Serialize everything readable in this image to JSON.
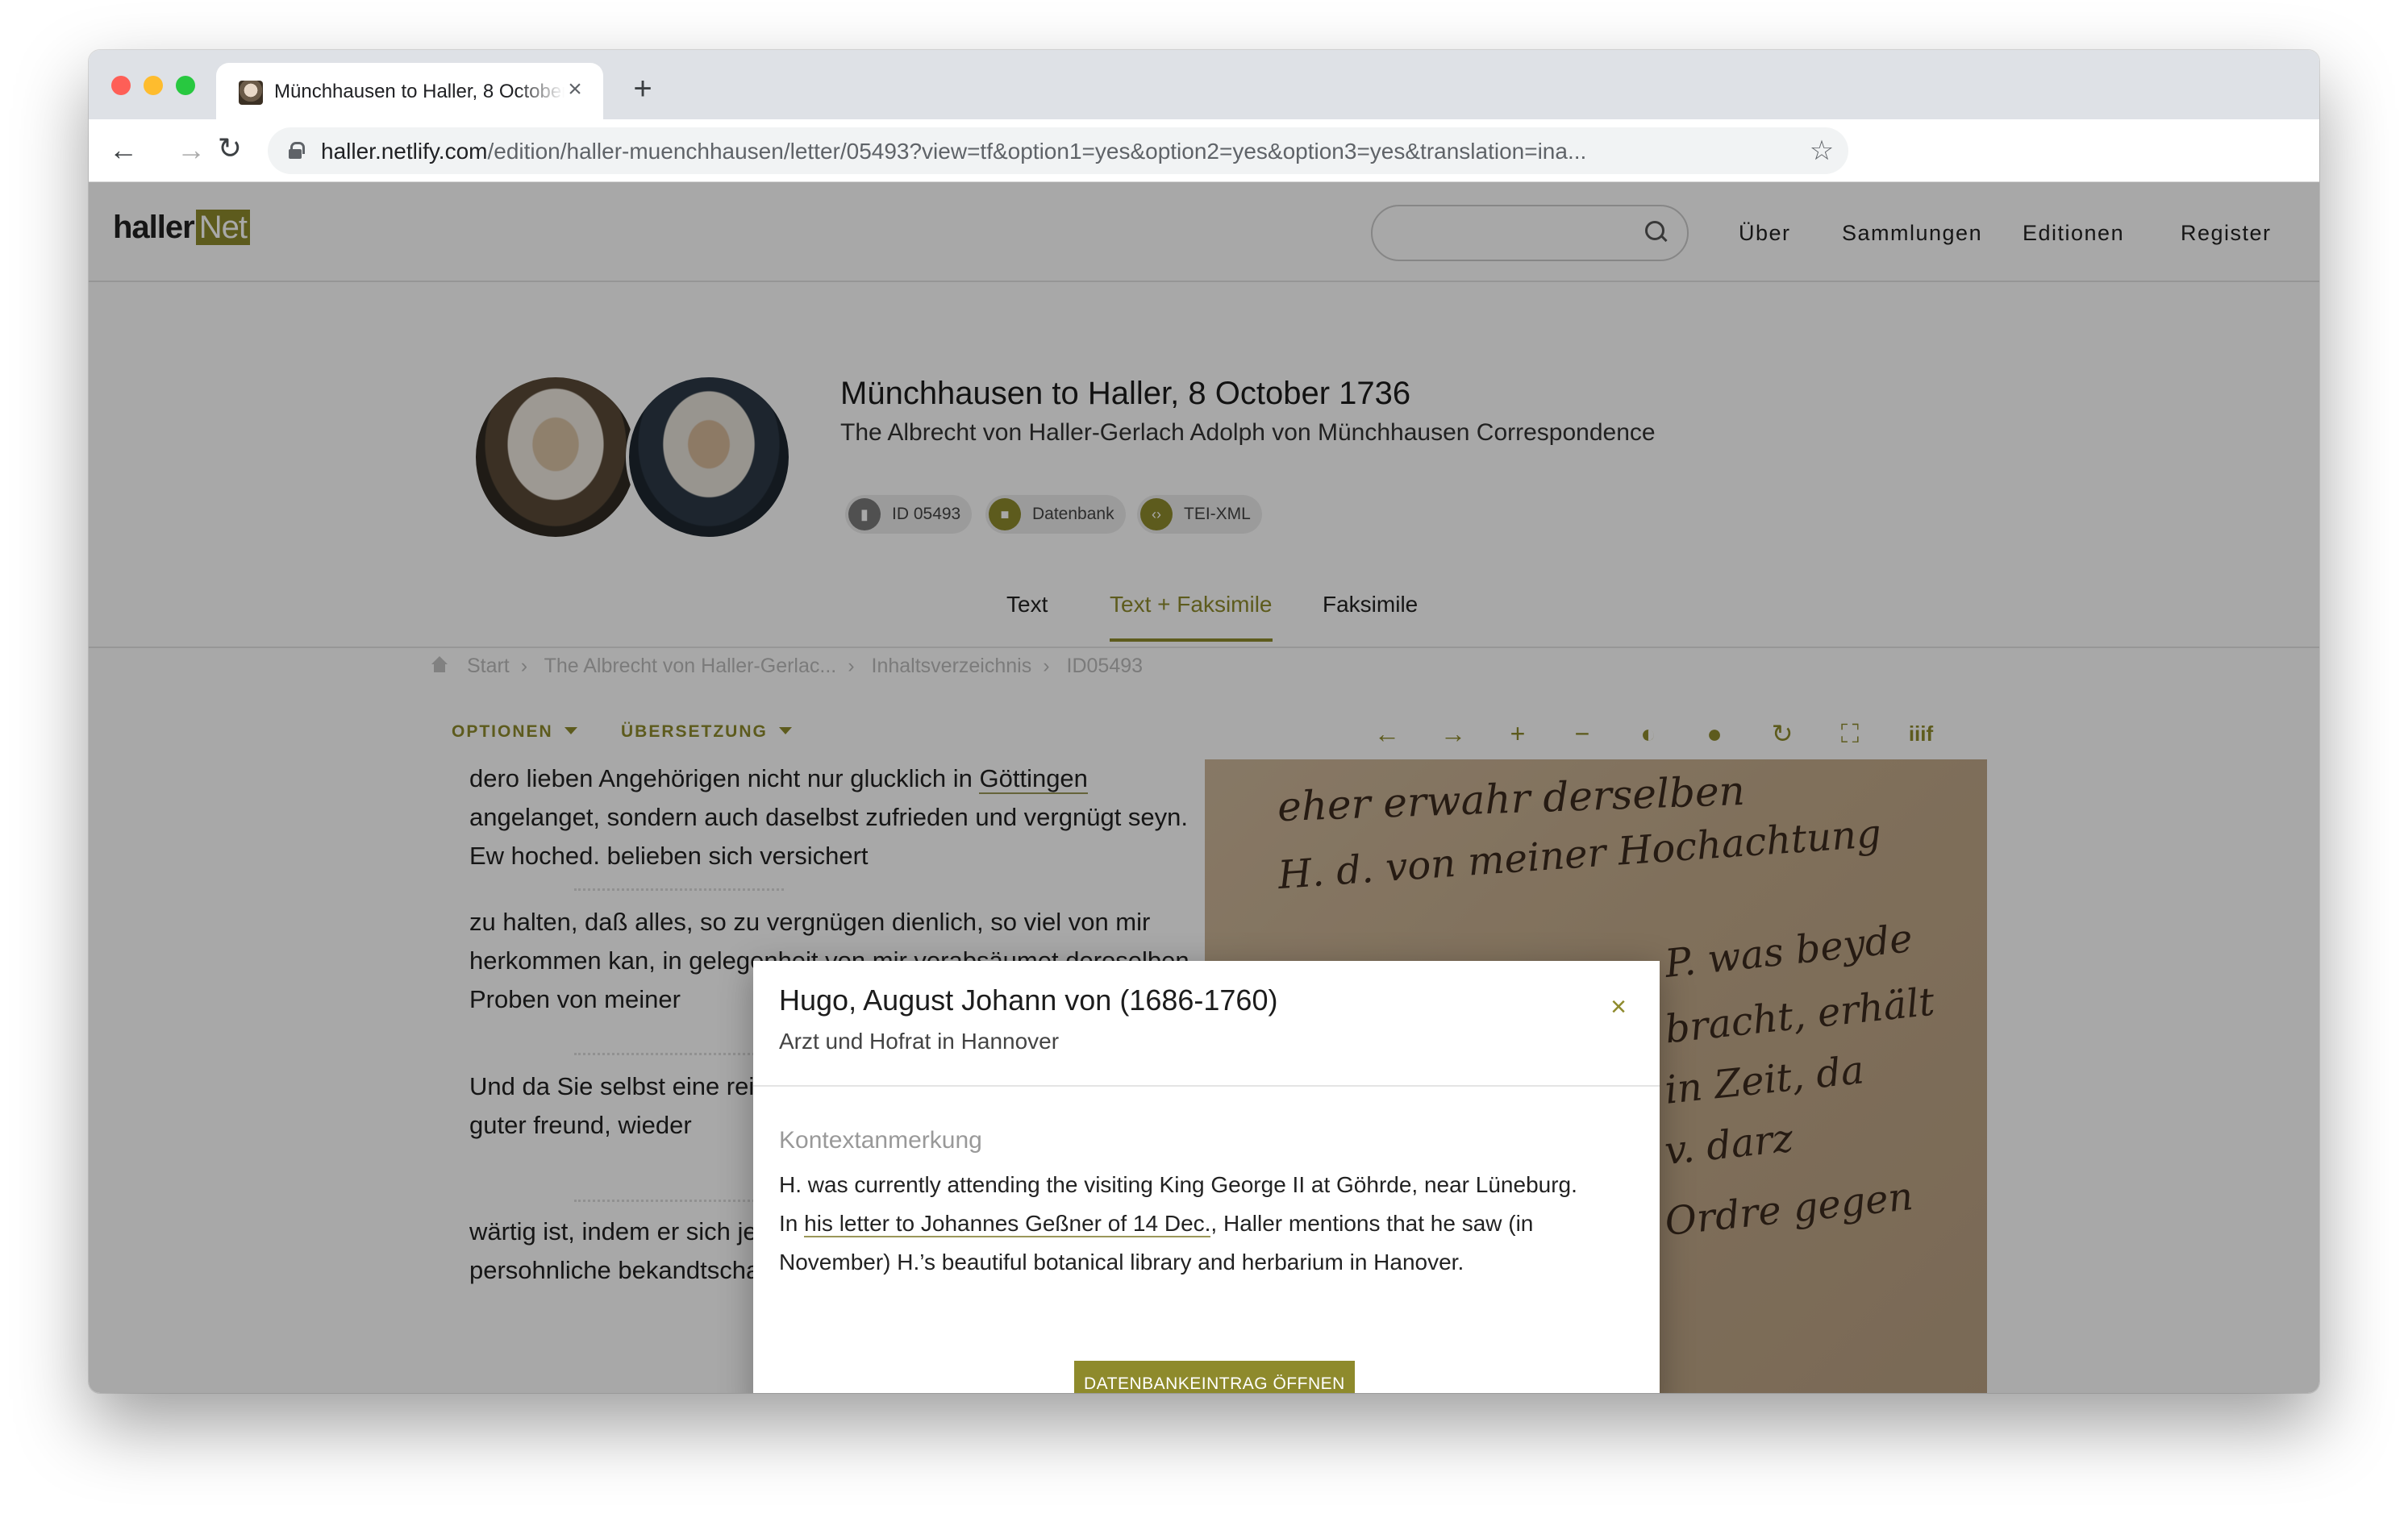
{
  "browser": {
    "tab_title": "Münchhausen to Haller, 8 October 1736",
    "new_tab_label": "+",
    "close_glyph": "×",
    "url_host": "haller.netlify.com",
    "url_path": "/edition/haller-muenchhausen/letter/05493?view=tf&option1=yes&option2=yes&option3=yes&translation=ina..."
  },
  "site": {
    "logo_main": "haller",
    "logo_accent": "Net",
    "accent_color": "#8e8a2c",
    "nav": [
      "Über",
      "Sammlungen",
      "Editionen",
      "Register"
    ]
  },
  "letter": {
    "title": "Münchhausen to Haller, 8 October 1736",
    "subtitle": "The Albrecht von Haller-Gerlach Adolph von Münchhausen Correspondence",
    "chips": [
      {
        "icon": "bookmark-icon",
        "label": "ID 05493"
      },
      {
        "icon": "database-icon",
        "label": "Datenbank"
      },
      {
        "icon": "code-icon",
        "label": "TEI-XML"
      }
    ]
  },
  "view_tabs": [
    "Text",
    "Text + Faksimile",
    "Faksimile"
  ],
  "breadcrumb": [
    "Start",
    "The Albrecht von Haller-Gerlac...",
    "Inhaltsverzeichnis",
    "ID05493"
  ],
  "options": {
    "optionen": "OPTIONEN",
    "uebersetzung": "ÜBERSETZUNG"
  },
  "viewer_tools": [
    "arrow-left-icon",
    "arrow-right-icon",
    "zoom-in-icon",
    "zoom-out-icon",
    "contrast-icon",
    "bulb-icon",
    "rotate-icon",
    "fullscreen-icon",
    "iiif-icon"
  ],
  "text": {
    "para1_a": "dero lieben Angehörigen nicht nur glucklich in ",
    "para1_link": "Göttingen",
    "para1_b": " angelanget, sondern auch daselbst zufrieden und vergnügt seyn. Ew hoched. belieben sich versichert",
    "para2": "zu halten, daß alles, so zu vergnügen dienlich, so viel von mir herkommen kan, in gelegenheit von mir verabsäumet deroselben Proben von meiner",
    "para3": "Und da Sie selbst eine reise welches vermuthlich gegen dero guter freund, wieder",
    "para4": "wärtig ist, indem er sich jetzo befindet, geschehen dürfte persohnliche bekandtschaft"
  },
  "facsimile_lines": [
    "eher erwahr derselben",
    "H. d. von meiner Hochachtung",
    "P. was beyde",
    "bracht, erhält",
    "in Zeit, da",
    "v. darz",
    "Ordre gegen"
  ],
  "modal": {
    "title": "Hugo, August Johann von (1686-1760)",
    "subtitle": "Arzt und Hofrat in Hannover",
    "close_glyph": "×",
    "section_label": "Kontextanmerkung",
    "body_a": "H. was currently attending the visiting King George II at Göhrde, near Lüneburg. In ",
    "body_link": "his letter to Johannes Geßner of 14 Dec.",
    "body_b": ", Haller mentions that he saw (in November) H.’s beautiful botanical library and herbarium in Hanover.",
    "cta": "DATENBANKEINTRAG ÖFFNEN"
  }
}
